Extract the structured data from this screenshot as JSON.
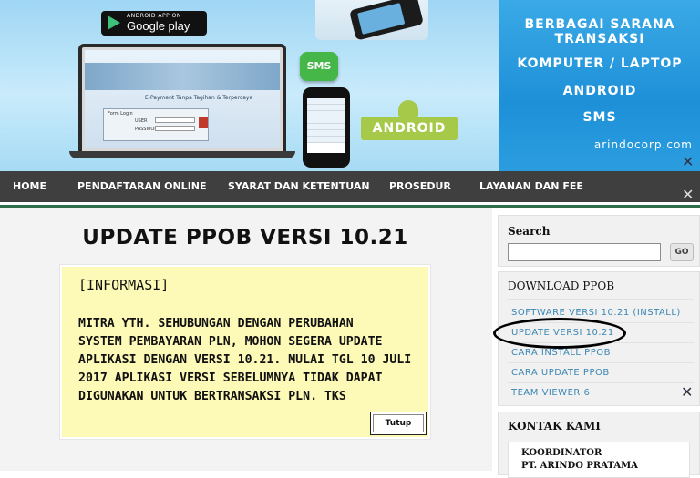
{
  "banner": {
    "store_badge": {
      "small": "ANDROID APP ON",
      "big": "Google play"
    },
    "laptop_tagline": "E-Payment Tanpa Tagihan & Terpercaya",
    "login": {
      "title": "Form Login",
      "user_label": "USER",
      "password_label": "PASSWORD"
    },
    "sms_label": "SMS",
    "android_label": "ANDROID",
    "promo_lines": [
      "BERBAGAI SARANA",
      "TRANSAKSI",
      "KOMPUTER / LAPTOP",
      "ANDROID",
      "SMS"
    ],
    "site": "arindocorp.com"
  },
  "nav": {
    "items": [
      "HOME",
      "PENDAFTARAN ONLINE",
      "SYARAT DAN KETENTUAN",
      "PROSEDUR",
      "LAYANAN DAN FEE"
    ]
  },
  "main": {
    "title": "UPDATE PPOB VERSI 10.21",
    "notice": {
      "heading": "[INFORMASI]",
      "lines": [
        "MITRA YTH. SEHUBUNGAN DENGAN PERUBAHAN",
        "SYSTEM PEMBAYARAN PLN, MOHON SEGERA UPDATE",
        "APLIKASI DENGAN VERSI 10.21. MULAI TGL 10 JULI",
        "2017 APLIKASI VERSI SEBELUMNYA TIDAK DAPAT",
        "DIGUNAKAN UNTUK BERTRANSAKSI PLN. TKS"
      ],
      "close_label": "Tutup"
    }
  },
  "sidebar": {
    "search": {
      "title": "Search",
      "value": "",
      "go_label": "GO"
    },
    "download": {
      "title": "DOWNLOAD PPOB",
      "links": [
        "SOFTWARE VERSI 10.21 (INSTALL)",
        "UPDATE VERSI 10.21",
        "CARA INSTALL PPOB",
        "CARA UPDATE PPOB",
        "TEAM VIEWER 6"
      ]
    },
    "contact": {
      "title": "KONTAK KAMI",
      "lines": [
        "KOORDINATOR",
        "PT. ARINDO PRATAMA"
      ]
    }
  },
  "colors": {
    "nav_bg": "#3f3f3f",
    "nav_accent": "#2f6d4a",
    "notice_bg": "#fdf9b6",
    "link": "#3a86b4",
    "banner_right": "#1e90d8"
  },
  "icons": [
    "google-play-icon",
    "sms-icon",
    "android-icon",
    "wrench-icon"
  ]
}
